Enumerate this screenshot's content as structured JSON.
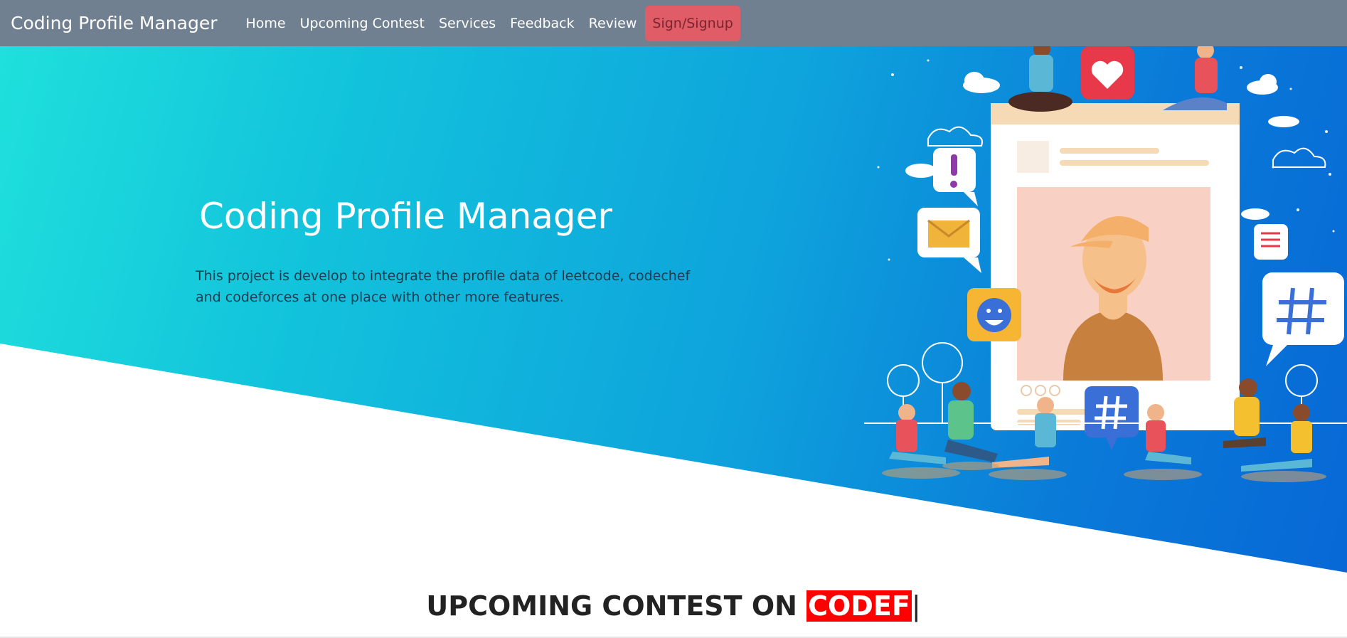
{
  "navbar": {
    "brand": "Coding Profile Manager",
    "items": [
      "Home",
      "Upcoming Contest",
      "Services",
      "Feedback",
      "Review"
    ],
    "signin": "Sign/Signup"
  },
  "hero": {
    "title": "Coding Profile Manager",
    "description": "This project is develop to integrate the profile data of leetcode, codechef and codeforces at one place with other more features."
  },
  "contest": {
    "prefix": "UPCOMING CONTEST ON ",
    "highlight": "CODEF",
    "caret": "|"
  },
  "colors": {
    "navbar": "#708090",
    "signin": "#e05d67",
    "hero_start": "#1fe0dc",
    "hero_end": "#0768d6",
    "highlight": "#ff0000"
  }
}
